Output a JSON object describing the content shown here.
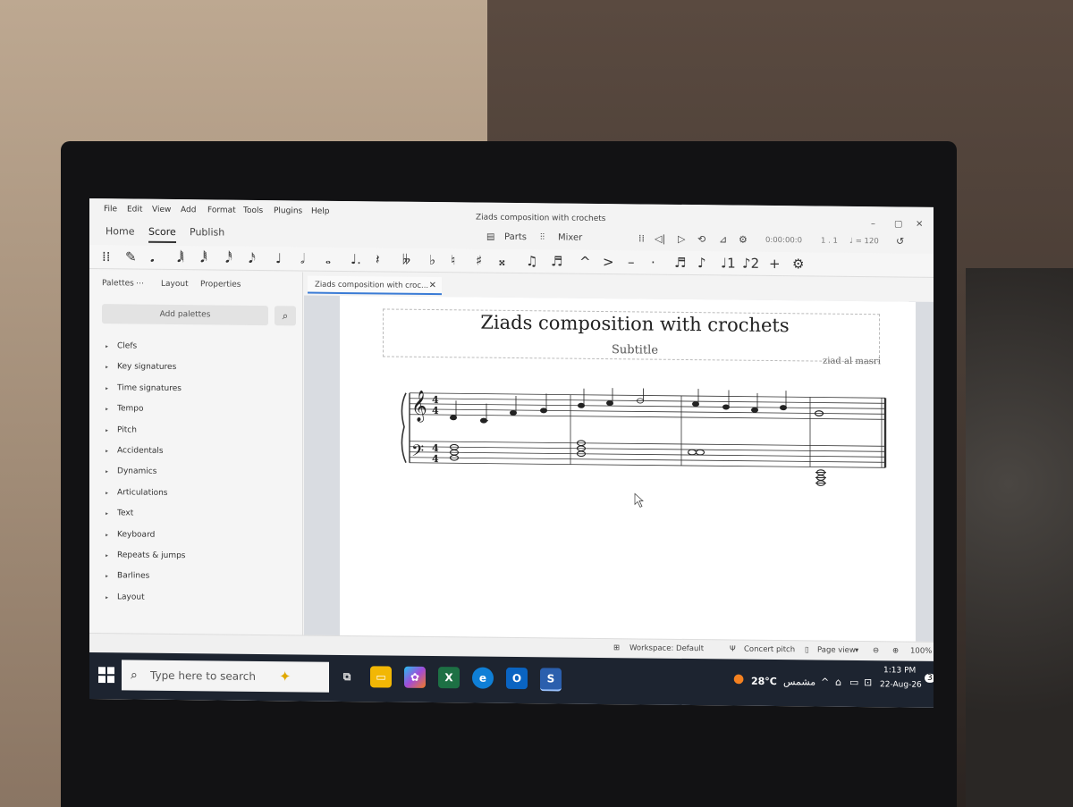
{
  "menu": [
    "File",
    "Edit",
    "View",
    "Add",
    "Format",
    "Tools",
    "Plugins",
    "Help"
  ],
  "window_title": "Ziads composition with crochets",
  "window_controls": {
    "minimize": "–",
    "maximize": "▢",
    "close": "✕"
  },
  "main_tabs": [
    "Home",
    "Score",
    "Publish"
  ],
  "toolbar": {
    "parts": "Parts",
    "mixer": "Mixer",
    "time": "0:00:00:0",
    "position": "1 . 1",
    "tempo": "♩ = 120"
  },
  "note_toolbar": [
    "⁞⁞",
    "✎",
    "𝅘",
    "𝅘𝅥𝅲",
    "𝅘𝅥𝅱",
    "𝅘𝅥𝅰",
    "𝅘𝅥𝅯",
    "♩",
    "𝅗𝅥",
    "𝅝",
    "♩.",
    "𝄽",
    "𝄫",
    "♭",
    "♮",
    "♯",
    "𝄪",
    "♫",
    "♬",
    "^",
    ">",
    "–",
    "·",
    "♬",
    "♪",
    "♩1",
    "♪2",
    "+",
    "⚙"
  ],
  "left_panel": {
    "tabs": [
      "Palettes",
      "⋯",
      "Layout",
      "Properties"
    ],
    "add_palettes": "Add palettes",
    "items": [
      "Clefs",
      "Key signatures",
      "Time signatures",
      "Tempo",
      "Pitch",
      "Accidentals",
      "Dynamics",
      "Articulations",
      "Text",
      "Keyboard",
      "Repeats & jumps",
      "Barlines",
      "Layout"
    ]
  },
  "doc_tab": "Ziads composition with croc...",
  "score": {
    "title": "Ziads composition with crochets",
    "subtitle": "Subtitle",
    "composer": "ziad al masri"
  },
  "status": {
    "workspace": "Workspace: Default",
    "concert_pitch": "Concert pitch",
    "view": "Page view",
    "zoom": "100%"
  },
  "taskbar": {
    "search_placeholder": "Type here to search",
    "weather": "28°C",
    "weather_label": "مشمس",
    "time": "1:13 PM",
    "date": "22-Aug-26",
    "notifications": "3"
  }
}
